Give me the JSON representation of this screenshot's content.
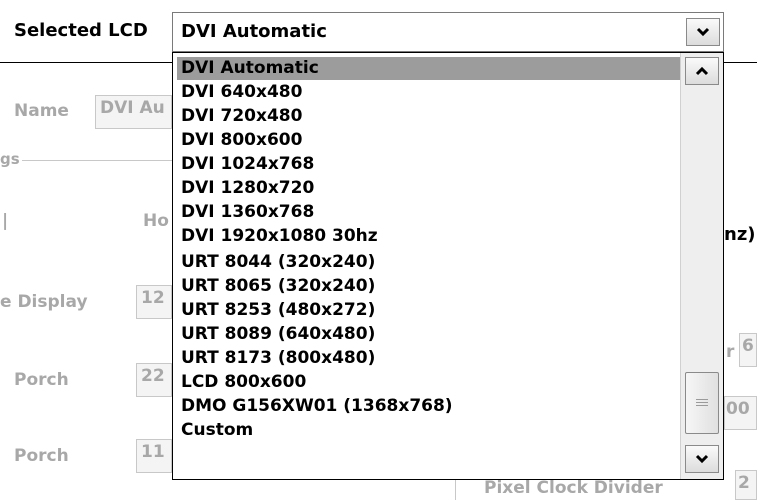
{
  "header": {
    "label": "Selected LCD"
  },
  "combo": {
    "value": "DVI Automatic"
  },
  "dropdown": {
    "items": [
      "DVI Automatic",
      "DVI 640x480",
      "DVI 720x480",
      "DVI 800x600",
      "DVI 1024x768",
      "DVI 1280x720",
      "DVI 1360x768",
      "DVI 1920x1080 30hz",
      "URT 8044 (320x240)",
      "URT 8065 (320x240)",
      "URT 8253 (480x272)",
      "URT 8089 (640x480)",
      "URT 8173 (800x480)",
      "LCD 800x600",
      "DMO G156XW01 (1368x768)",
      "Custom"
    ],
    "selected_index": 0
  },
  "background": {
    "name_label": "Name",
    "name_value": "DVI Au",
    "group_fragment": "gs",
    "col_fragment": "Ho",
    "display_label": "e Display",
    "display_value": "12",
    "porch1_label": "Porch",
    "porch1_value": "22",
    "porch2_label": "Porch",
    "porch2_value": "11",
    "hz_fragment": "nz)",
    "r_fragment": "r",
    "r_value": "6",
    "oo_value": "00",
    "pixel_clock_label": "Pixel Clock Divider",
    "pixel_clock_value": "2"
  }
}
